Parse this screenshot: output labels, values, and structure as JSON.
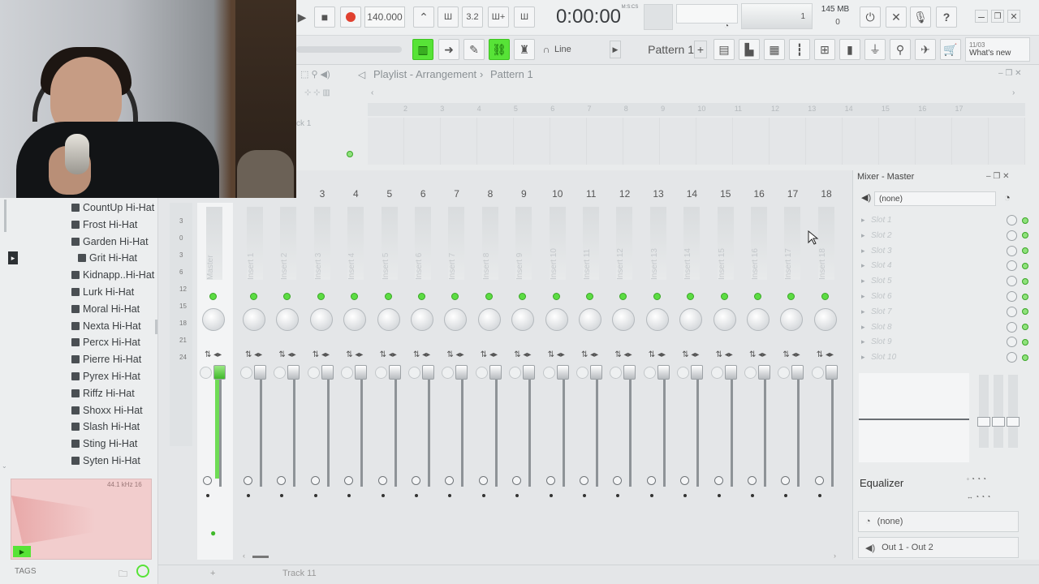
{
  "toolbar": {
    "tempo": "140.000",
    "time": "0:00:00",
    "time_label": "M:S:CS",
    "cpu_label": "1",
    "mem": "145 MB",
    "mem_sub": "0",
    "pattern": "Pattern 1",
    "snap": "Line",
    "news_date": "11/03",
    "news": "What's new"
  },
  "playlist": {
    "title": "Playlist - Arrangement",
    "pattern": "Pattern 1",
    "track_label": "ck 1",
    "ruler": [
      "2",
      "3",
      "4",
      "5",
      "6",
      "7",
      "8",
      "9",
      "10",
      "11",
      "12",
      "13",
      "14",
      "15",
      "16",
      "17"
    ],
    "bottom_track": "Track 11"
  },
  "browser": {
    "items": [
      "CountUp Hi-Hat",
      "Frost Hi-Hat",
      "Garden Hi-Hat",
      "Grit Hi-Hat",
      "Kidnapp..Hi-Hat",
      "Lurk Hi-Hat",
      "Moral Hi-Hat",
      "Nexta Hi-Hat",
      "Percx Hi-Hat",
      "Pierre Hi-Hat",
      "Pyrex Hi-Hat",
      "Riffz Hi-Hat",
      "Shoxx Hi-Hat",
      "Slash Hi-Hat",
      "Sting Hi-Hat",
      "Syten Hi-Hat"
    ],
    "wave_info": "44.1 kHz 16",
    "tags": "TAGS"
  },
  "mixer": {
    "numbers": [
      "3",
      "4",
      "5",
      "6",
      "7",
      "8",
      "9",
      "10",
      "11",
      "12",
      "13",
      "14",
      "15",
      "16",
      "17",
      "18"
    ],
    "strips": [
      "Master",
      "Insert 1",
      "Insert 2",
      "Insert 3",
      "Insert 4",
      "Insert 5",
      "Insert 6",
      "Insert 7",
      "Insert 8",
      "Insert 9",
      "Insert 10",
      "Insert 11",
      "Insert 12",
      "Insert 13",
      "Insert 14",
      "Insert 15",
      "Insert 16",
      "Insert 17",
      "Insert 18"
    ],
    "db_scale": [
      "3",
      "0",
      "3",
      "6",
      "12",
      "15",
      "18",
      "21",
      "24"
    ]
  },
  "mixpanel": {
    "title": "Mixer - Master",
    "input": "(none)",
    "slots": [
      "Slot 1",
      "Slot 2",
      "Slot 3",
      "Slot 4",
      "Slot 5",
      "Slot 6",
      "Slot 7",
      "Slot 8",
      "Slot 9",
      "Slot 10"
    ],
    "eq_label": "Equalizer",
    "send": "(none)",
    "output": "Out 1 - Out 2"
  },
  "colors": {
    "accent_green": "#57e337",
    "record_red": "#e0402f"
  }
}
